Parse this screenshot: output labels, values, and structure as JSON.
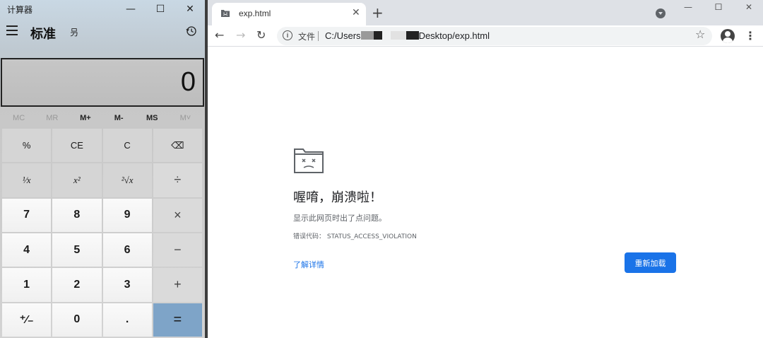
{
  "calculator": {
    "window_title": "计算器",
    "window_controls": {
      "minimize": "—",
      "maximize": "☐",
      "close": "✕"
    },
    "mode": "标准",
    "keep_on_top_icon": "叧",
    "display_value": "0",
    "memory": [
      {
        "label": "MC",
        "enabled": false
      },
      {
        "label": "MR",
        "enabled": false
      },
      {
        "label": "M+",
        "enabled": true
      },
      {
        "label": "M-",
        "enabled": true
      },
      {
        "label": "MS",
        "enabled": true
      },
      {
        "label": "M˅",
        "enabled": false
      }
    ],
    "keys": {
      "percent": "%",
      "ce": "CE",
      "c": "C",
      "backspace": "⌫",
      "reciprocal": "¹⁄x",
      "square": "x²",
      "sqrt": "²√x",
      "divide": "÷",
      "n7": "7",
      "n8": "8",
      "n9": "9",
      "multiply": "×",
      "n4": "4",
      "n5": "5",
      "n6": "6",
      "minus": "−",
      "n1": "1",
      "n2": "2",
      "n3": "3",
      "plus": "+",
      "negate": "⁺⁄₋",
      "n0": "0",
      "decimal": ".",
      "equals": "="
    }
  },
  "browser": {
    "tab_title": "exp.html",
    "tab_close": "✕",
    "new_tab": "+",
    "window_controls": {
      "minimize": "—",
      "maximize": "☐",
      "close": "✕"
    },
    "nav": {
      "back": "←",
      "forward": "→",
      "reload": "↻"
    },
    "omnibox": {
      "info_icon": "i",
      "file_label": "文件",
      "url_prefix": "C:/Users",
      "url_suffix": "Desktop/exp.html"
    },
    "star": "☆",
    "menu": "⋮",
    "error": {
      "title": "喔唷，崩溃啦！",
      "description": "显示此网页时出了点问题。",
      "code": "错误代码：  STATUS_ACCESS_VIOLATION",
      "learn_more": "了解详情",
      "reload_button": "重新加载"
    }
  },
  "colors": {
    "accent_blue": "#1a73e8",
    "equals_key": "#7ea4c8",
    "tabstrip": "#dee1e6"
  }
}
